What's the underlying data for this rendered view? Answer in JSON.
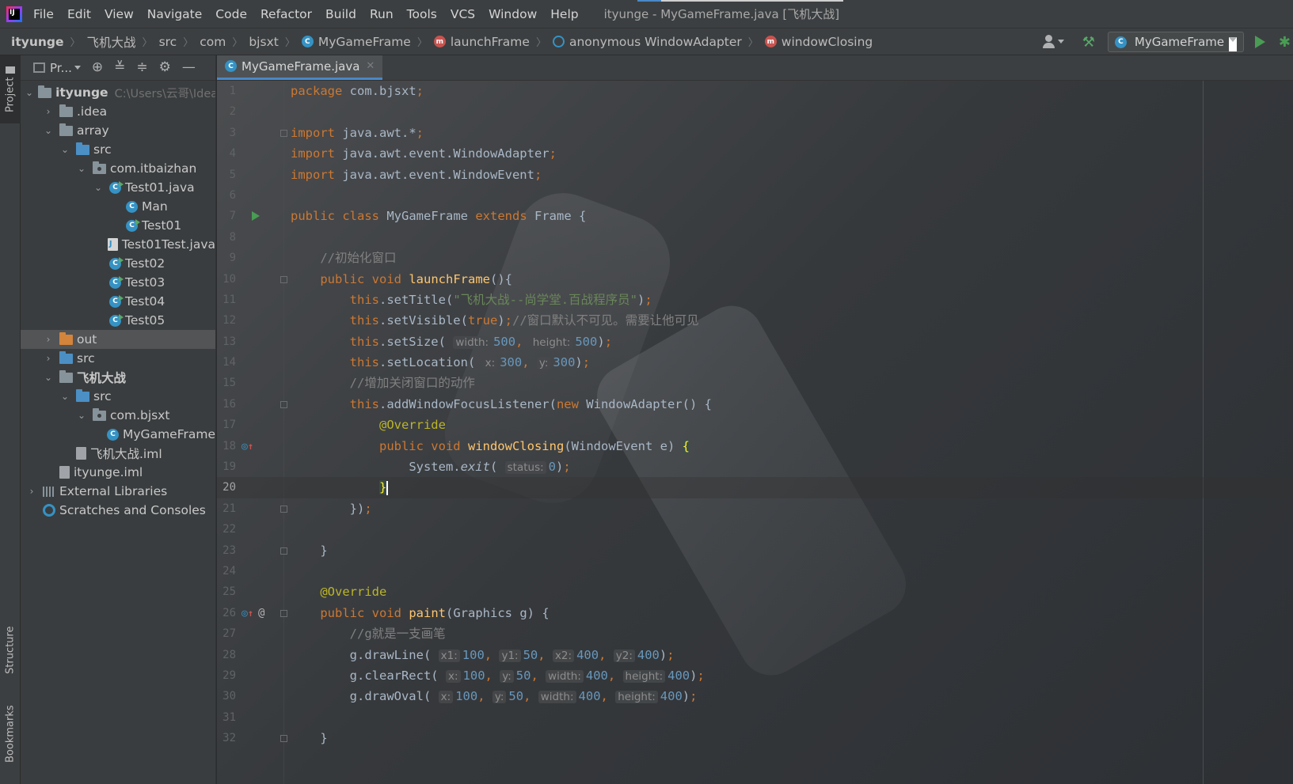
{
  "menubar": {
    "logo_text": "IJ",
    "items": [
      "File",
      "Edit",
      "View",
      "Navigate",
      "Code",
      "Refactor",
      "Build",
      "Run",
      "Tools",
      "VCS",
      "Window",
      "Help"
    ],
    "window_title": "ityunge - MyGameFrame.java [飞机大战]"
  },
  "breadcrumb": {
    "items": [
      "ityunge",
      "飞机大战",
      "src",
      "com",
      "bjsxt",
      "MyGameFrame",
      "launchFrame",
      "anonymous WindowAdapter",
      "windowClosing"
    ]
  },
  "toolbar": {
    "run_config": "MyGameFrame"
  },
  "sidebar": {
    "project_tab": "Project",
    "structure_tab": "Structure",
    "bookmarks_tab": "Bookmarks"
  },
  "project_panel": {
    "title": "Pr...",
    "root_path": "C:\\Users\\云哥\\IdeaP",
    "tree": [
      {
        "label": "ityunge",
        "depth": 0,
        "expanded": true,
        "icon": "module-folder-icon"
      },
      {
        "label": ".idea",
        "depth": 1,
        "expanded": false,
        "icon": "folder-icon"
      },
      {
        "label": "array",
        "depth": 1,
        "expanded": true,
        "icon": "module-folder-icon"
      },
      {
        "label": "src",
        "depth": 2,
        "expanded": true,
        "icon": "source-folder-icon"
      },
      {
        "label": "com.itbaizhan",
        "depth": 3,
        "expanded": true,
        "icon": "package-icon"
      },
      {
        "label": "Test01.java",
        "depth": 4,
        "expanded": true,
        "icon": "class-icon"
      },
      {
        "label": "Man",
        "depth": 5,
        "icon": "class-icon"
      },
      {
        "label": "Test01",
        "depth": 5,
        "icon": "class-icon"
      },
      {
        "label": "Test01Test.java",
        "depth": 4,
        "icon": "java-file-icon"
      },
      {
        "label": "Test02",
        "depth": 4,
        "icon": "class-icon"
      },
      {
        "label": "Test03",
        "depth": 4,
        "icon": "class-icon"
      },
      {
        "label": "Test04",
        "depth": 4,
        "icon": "class-icon"
      },
      {
        "label": "Test05",
        "depth": 4,
        "icon": "class-icon"
      },
      {
        "label": "out",
        "depth": 1,
        "expanded": false,
        "icon": "excluded-folder-icon"
      },
      {
        "label": "src",
        "depth": 1,
        "expanded": false,
        "icon": "source-folder-icon"
      },
      {
        "label": "飞机大战",
        "depth": 1,
        "expanded": true,
        "icon": "module-folder-icon"
      },
      {
        "label": "src",
        "depth": 2,
        "expanded": true,
        "icon": "source-folder-icon"
      },
      {
        "label": "com.bjsxt",
        "depth": 3,
        "expanded": true,
        "icon": "package-icon"
      },
      {
        "label": "MyGameFrame",
        "depth": 4,
        "icon": "class-icon"
      },
      {
        "label": "飞机大战.iml",
        "depth": 2,
        "icon": "iml-file-icon"
      },
      {
        "label": "ityunge.iml",
        "depth": 1,
        "icon": "iml-file-icon"
      },
      {
        "label": "External Libraries",
        "depth": 0,
        "expanded": false,
        "icon": "libraries-icon"
      },
      {
        "label": "Scratches and Consoles",
        "depth": 0,
        "icon": "scratches-icon"
      }
    ]
  },
  "editor": {
    "tab_label": "MyGameFrame.java",
    "current_line": 20,
    "lines": [
      {
        "n": 1,
        "html": "<span class=\"kw\">package</span> <span class=\"pl\">com.bjsxt</span><span class=\"kw\">;</span>"
      },
      {
        "n": 2,
        "html": ""
      },
      {
        "n": 3,
        "html": "<span class=\"kw\">import</span> <span class=\"pl\">java.awt.*</span><span class=\"kw\">;</span>",
        "fold": true
      },
      {
        "n": 4,
        "html": "<span class=\"kw\">import</span> <span class=\"pl\">java.awt.event.WindowAdapter</span><span class=\"kw\">;</span>"
      },
      {
        "n": 5,
        "html": "<span class=\"kw\">import</span> <span class=\"pl\">java.awt.event.WindowEvent</span><span class=\"kw\">;</span>"
      },
      {
        "n": 6,
        "html": ""
      },
      {
        "n": 7,
        "html": "<span class=\"kw\">public class</span> <span class=\"cls\">MyGameFrame</span> <span class=\"kw\">extends</span> <span class=\"cls\">Frame</span> <span class=\"pl\">{</span>",
        "run": true
      },
      {
        "n": 8,
        "html": ""
      },
      {
        "n": 9,
        "html": "    <span class=\"cmt\">//初始化窗口</span>"
      },
      {
        "n": 10,
        "html": "    <span class=\"kw\">public void</span> <span class=\"fn\">launchFrame</span><span class=\"pl\">(){</span>",
        "fold": true
      },
      {
        "n": 11,
        "html": "        <span class=\"kw\">this</span><span class=\"pl\">.setTitle(</span><span class=\"str\">\"飞机大战--尚学堂.百战程序员\"</span><span class=\"pl\">)</span><span class=\"kw\">;</span>"
      },
      {
        "n": 12,
        "html": "        <span class=\"kw\">this</span><span class=\"pl\">.setVisible(</span><span class=\"kw\">true</span><span class=\"pl\">)</span><span class=\"kw\">;</span><span class=\"cmt\">//窗口默认不可见。需要让他可见</span>"
      },
      {
        "n": 13,
        "html": "        <span class=\"kw\">this</span><span class=\"pl\">.setSize( </span><span class=\"hint\">width:</span><span class=\"num\">500</span><span class=\"kw\">, </span><span class=\"hint\">height:</span><span class=\"num\">500</span><span class=\"pl\">)</span><span class=\"kw\">;</span>"
      },
      {
        "n": 14,
        "html": "        <span class=\"kw\">this</span><span class=\"pl\">.setLocation( </span><span class=\"hint\">x:</span><span class=\"num\">300</span><span class=\"kw\">, </span><span class=\"hint\">y:</span><span class=\"num\">300</span><span class=\"pl\">)</span><span class=\"kw\">;</span>"
      },
      {
        "n": 15,
        "html": "        <span class=\"cmt\">//增加关闭窗口的动作</span>"
      },
      {
        "n": 16,
        "html": "        <span class=\"kw\">this</span><span class=\"pl\">.addWindowFocusListener(</span><span class=\"kw\">new</span> <span class=\"cls\">WindowAdapter</span><span class=\"pl\">() {</span>",
        "fold": true
      },
      {
        "n": 17,
        "html": "            <span class=\"ann\">@Override</span>"
      },
      {
        "n": 18,
        "html": "            <span class=\"kw\">public void</span> <span class=\"fn\">windowClosing</span><span class=\"pl\">(</span><span class=\"cls\">WindowEvent</span> <span class=\"pl\">e) </span><span class=\"brace-hl\">{</span>",
        "override": true
      },
      {
        "n": 19,
        "html": "                <span class=\"pl\">System.<i>exit</i>( </span><span class=\"hint\">status:</span><span class=\"num\">0</span><span class=\"pl\">)</span><span class=\"kw\">;</span>"
      },
      {
        "n": 20,
        "html": "            <span class=\"brace-hl\">}</span><span class=\"caret\"></span>"
      },
      {
        "n": 21,
        "html": "        <span class=\"pl\">})</span><span class=\"kw\">;</span>",
        "fold": true
      },
      {
        "n": 22,
        "html": ""
      },
      {
        "n": 23,
        "html": "    <span class=\"pl\">}</span>",
        "fold": true
      },
      {
        "n": 24,
        "html": ""
      },
      {
        "n": 25,
        "html": "    <span class=\"ann\">@Override</span>"
      },
      {
        "n": 26,
        "html": "    <span class=\"kw\">public void</span> <span class=\"fn\">paint</span><span class=\"pl\">(</span><span class=\"cls\">Graphics</span> <span class=\"pl\">g) {</span>",
        "override": true,
        "at": true,
        "fold": true
      },
      {
        "n": 27,
        "html": "        <span class=\"cmt\">//g就是一支画笔</span>"
      },
      {
        "n": 28,
        "html": "        <span class=\"pl\">g.drawLine( </span><span class=\"hint\">x1:</span><span class=\"num\">100</span><span class=\"kw\">, </span><span class=\"hint\">y1:</span><span class=\"num\">50</span><span class=\"kw\">, </span><span class=\"hint\">x2:</span><span class=\"num\">400</span><span class=\"kw\">, </span><span class=\"hint\">y2:</span><span class=\"num\">400</span><span class=\"pl\">)</span><span class=\"kw\">;</span>"
      },
      {
        "n": 29,
        "html": "        <span class=\"pl\">g.clearRect( </span><span class=\"hint\">x:</span><span class=\"num\">100</span><span class=\"kw\">, </span><span class=\"hint\">y:</span><span class=\"num\">50</span><span class=\"kw\">, </span><span class=\"hint\">width:</span><span class=\"num\">400</span><span class=\"kw\">, </span><span class=\"hint\">height:</span><span class=\"num\">400</span><span class=\"pl\">)</span><span class=\"kw\">;</span>"
      },
      {
        "n": 30,
        "html": "        <span class=\"pl\">g.drawOval( </span><span class=\"hint\">x:</span><span class=\"num\">100</span><span class=\"kw\">, </span><span class=\"hint\">y:</span><span class=\"num\">50</span><span class=\"kw\">, </span><span class=\"hint\">width:</span><span class=\"num\">400</span><span class=\"kw\">, </span><span class=\"hint\">height:</span><span class=\"num\">400</span><span class=\"pl\">)</span><span class=\"kw\">;</span>"
      },
      {
        "n": 31,
        "html": ""
      },
      {
        "n": 32,
        "html": "    <span class=\"pl\">}</span>",
        "fold": true
      }
    ]
  }
}
